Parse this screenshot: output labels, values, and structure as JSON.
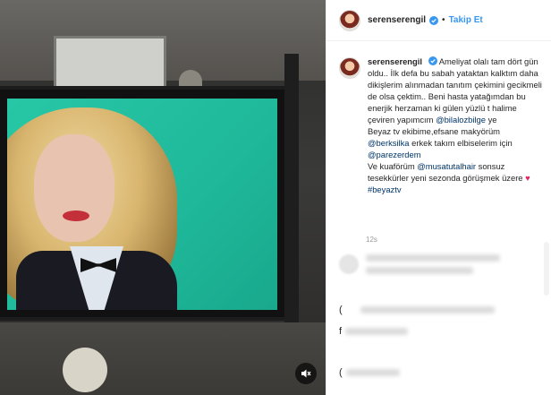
{
  "post": {
    "username": "serenserengil",
    "dot": "•",
    "follow_label": "Takip Et",
    "caption": {
      "p1": "Ameliyat olalı tam dört gün oldu.. İlk defa bu sabah yataktan kalktım daha dikişlerim alınmadan tanıtım çekimini gecikmeli de olsa çektim.. Beni hasta yatağımdan bu enerjik herzaman ki gülen yüzlü t halime çeviren yapımcım",
      "mention1": "@bilalozbilge",
      "p2": "ye",
      "p3": "Beyaz tv ekibime,efsane makyörüm",
      "mention2": "@berksilka",
      "p4": "erkek takım elbiselerim için",
      "mention3": "@parezerdem",
      "p5": "Ve kuaförüm",
      "mention4": "@musatutalhair",
      "p6": "sonsuz tesekkürler yeni sezonda görüşmek üzere",
      "heart": "♥",
      "hashtag": "#beyaztv"
    },
    "time": "12s"
  },
  "comments": {
    "paren_1": "(",
    "char_2": "f",
    "paren_3": "("
  },
  "colors": {
    "link": "#3897f0",
    "mention": "#003569",
    "heart": "#e0245e"
  }
}
